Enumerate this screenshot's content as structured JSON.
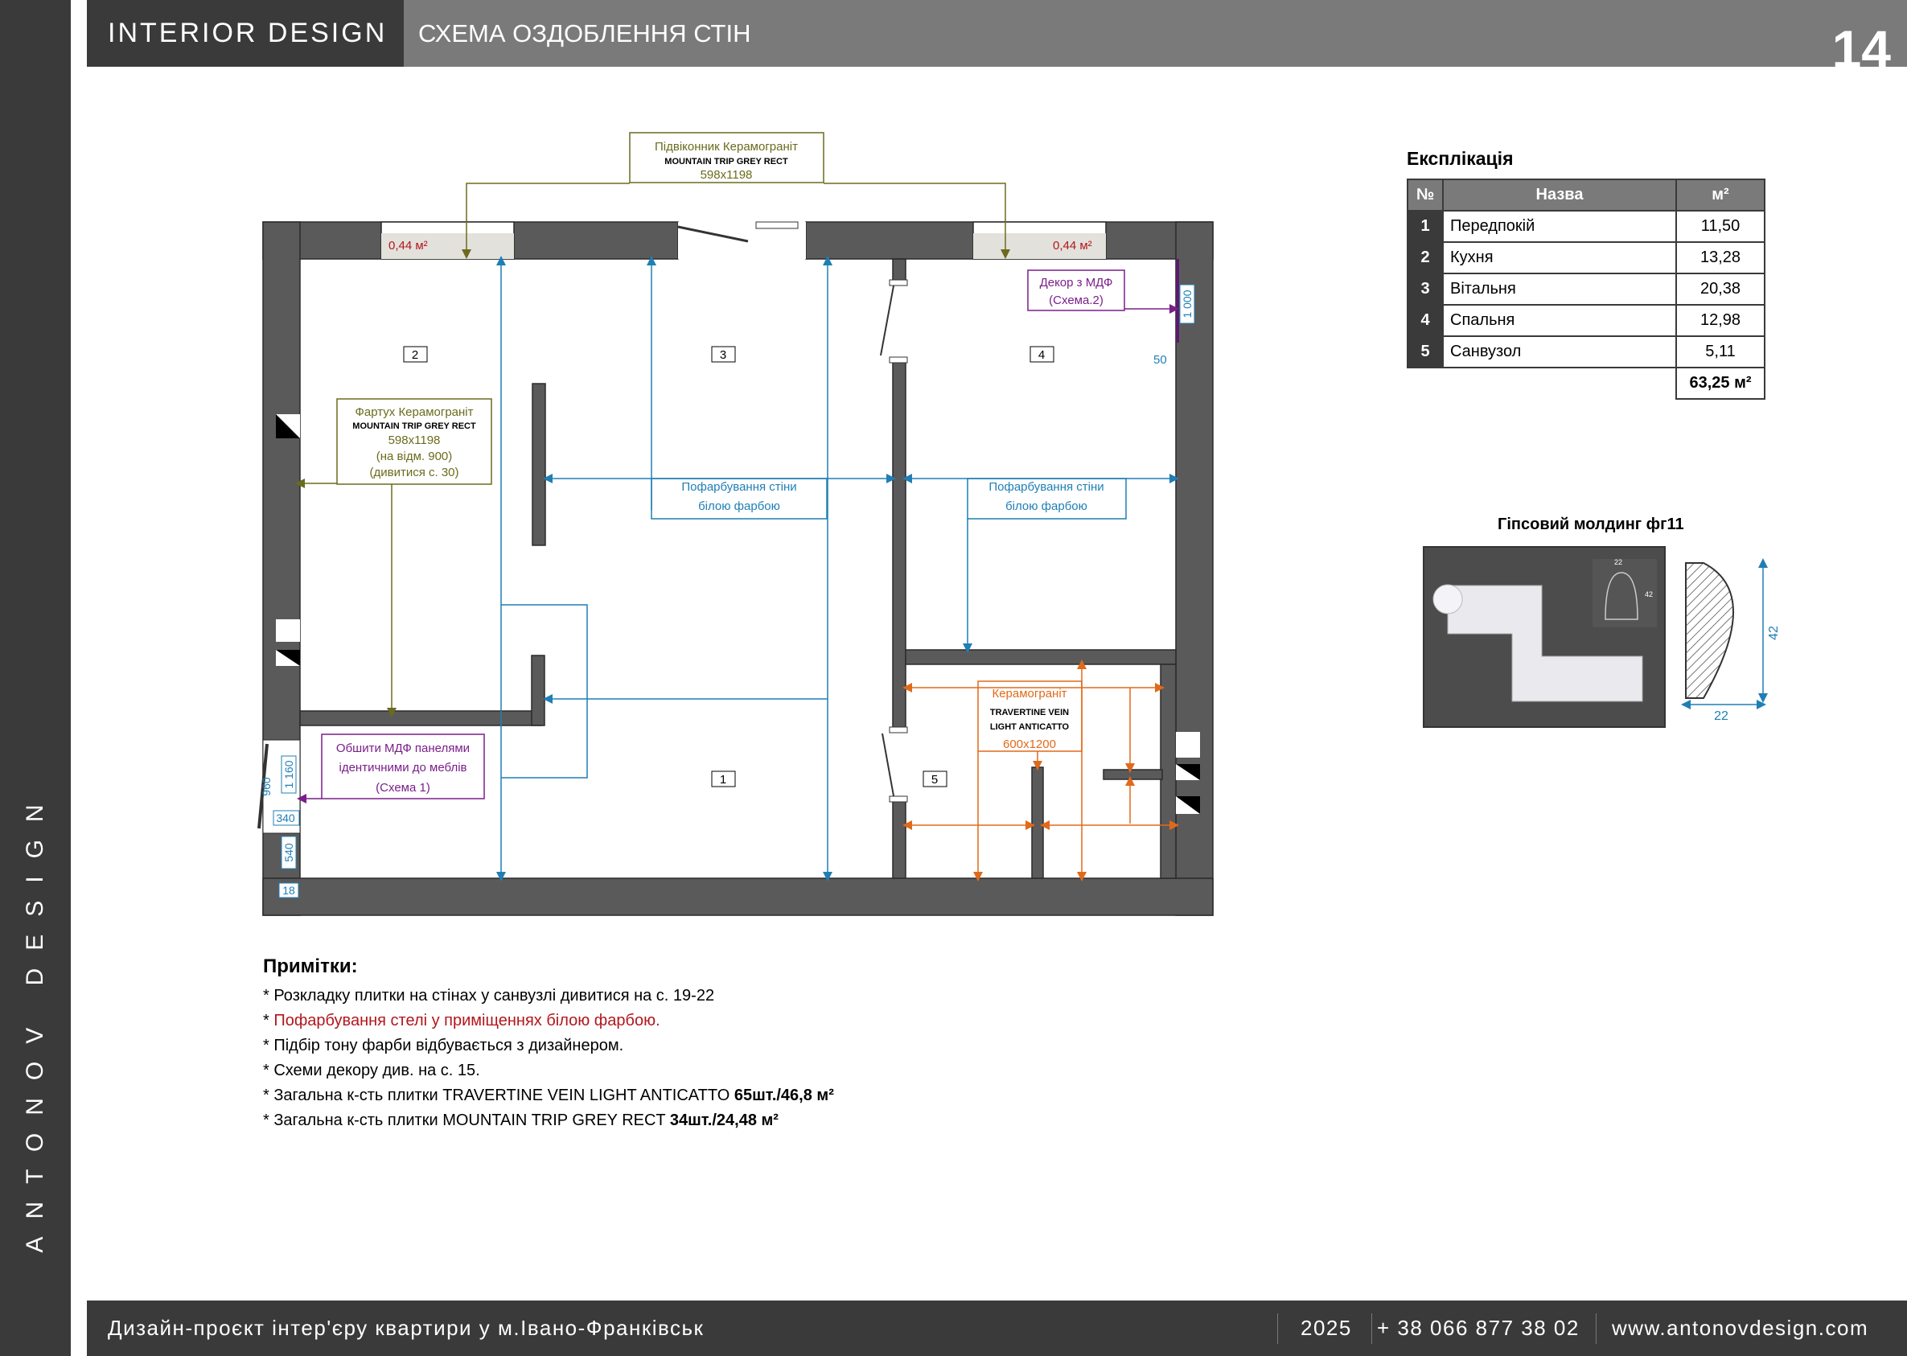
{
  "sidebar": {
    "brand_vertical": "ANTONOV DESIGN"
  },
  "header": {
    "brand": "INTERIOR  DESIGN",
    "title": "СХЕМА ОЗДОБЛЕННЯ СТІН",
    "page_number": "14"
  },
  "plan": {
    "rooms": [
      "1",
      "2",
      "3",
      "4",
      "5"
    ],
    "windowsill": {
      "title": "Підвіконник Керамограніт",
      "name": "MOUNTAIN TRIP GREY RECT",
      "size": "598x1198"
    },
    "area_left": "0,44 м²",
    "area_right": "0,44 м²",
    "decor_mdf": {
      "line1": "Декор з МДФ",
      "line2": "(Схема.2)"
    },
    "dim_1000": "1 000",
    "dim_50": "50",
    "apron": {
      "title": "Фартух Керамограніт",
      "name": "MOUNTAIN TRIP GREY RECT",
      "size": "598x1198",
      "mark": "(на відм. 900)",
      "ref": "(дивитися с. 30)"
    },
    "paint_1": {
      "line1": "Пофарбування стіни",
      "line2": "білою фарбою"
    },
    "paint_2": {
      "line1": "Пофарбування стіни",
      "line2": "білою фарбою"
    },
    "mdf_panels": {
      "line1": "Обшити МДФ панелями",
      "line2": "ідентичними до меблів",
      "line3": "(Схема 1)"
    },
    "porcelain": {
      "title": "Керамограніт",
      "name1": "TRAVERTINE VEIN",
      "name2": "LIGHT ANTICATTO",
      "size": "600x1200"
    },
    "dims_left": {
      "d960": "960",
      "d1160": "1 160",
      "d340": "340",
      "d540": "540",
      "d18": "18"
    }
  },
  "notes": {
    "title": "Примітки:",
    "items": [
      "* Розкладку плитки на стінах у санвузлі дивитися на с. 19-22",
      "Пофарбування стелі у приміщеннях білою фарбою.",
      "* Підбір тону фарби відбувається з дизайнером.",
      "* Схеми декору див. на с. 15.",
      "* Загальна к-сть плитки TRAVERTINE VEIN LIGHT ANTICATTO",
      "65шт./46,8 м²",
      "* Загальна к-сть плитки MOUNTAIN TRIP GREY RECT",
      "34шт./24,48 м²"
    ]
  },
  "explication": {
    "title": "Експлікація",
    "headers": [
      "№",
      "Назва",
      "м²"
    ],
    "rows": [
      [
        "1",
        "Передпокій",
        "11,50"
      ],
      [
        "2",
        "Кухня",
        "13,28"
      ],
      [
        "3",
        "Вітальня",
        "20,38"
      ],
      [
        "4",
        "Спальня",
        "12,98"
      ],
      [
        "5",
        "Санвузол",
        "5,11"
      ]
    ],
    "total": "63,25 м²"
  },
  "molding": {
    "title": "Гіпсовий молдинг фг11",
    "height": "42",
    "width": "22",
    "small_w": "22",
    "small_h": "42"
  },
  "footer": {
    "project": "Дизайн-проєкт інтер'єру квартири у м.Івано-Франківськ",
    "year": "2025",
    "phone": "+ 38 066 877 38 02",
    "website": "www.antonovdesign.com"
  },
  "colors": {
    "dark": "#3a3a3a",
    "mid": "#7a7a7a",
    "wall": "#555555",
    "blue": "#1f7fb5",
    "olive": "#6b6b1e",
    "purple": "#7a1f8a",
    "orange": "#e06a1a",
    "red": "#b3161c"
  }
}
